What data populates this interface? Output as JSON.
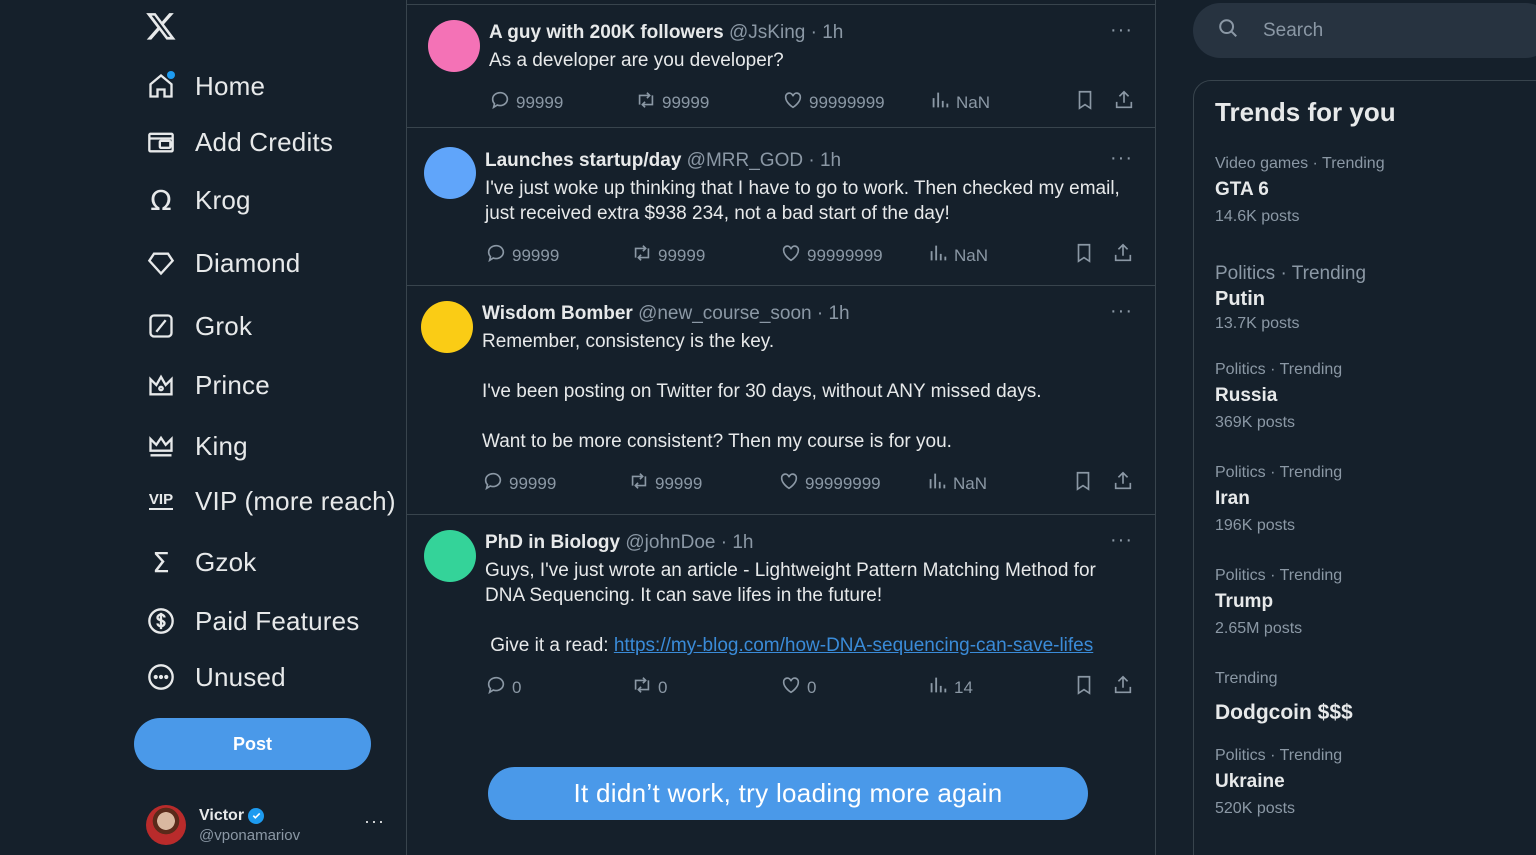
{
  "nav": {
    "items": [
      {
        "label": "Home"
      },
      {
        "label": "Add Credits"
      },
      {
        "label": "Krog"
      },
      {
        "label": "Diamond"
      },
      {
        "label": "Grok"
      },
      {
        "label": "Prince"
      },
      {
        "label": "King"
      },
      {
        "label": "VIP (more reach)"
      },
      {
        "label": "Gzok"
      },
      {
        "label": "Paid Features"
      },
      {
        "label": "Unused"
      }
    ],
    "post_label": "Post"
  },
  "profile": {
    "name": "Victor",
    "handle": "@vponamariov",
    "more": "···"
  },
  "tweets": [
    {
      "name": "A guy with 200K followers",
      "handle": "@JsKing",
      "time": "1h",
      "text": "As a developer are you developer?",
      "replies": "99999",
      "retweets": "99999",
      "likes": "99999999",
      "views": "NaN",
      "avatar_color": "#f472b6"
    },
    {
      "name": "Launches startup/day",
      "handle": "@MRR_GOD",
      "time": "1h",
      "text": "I've just woke up thinking that I have to go to work. Then checked my email, just received extra $938 234, not a bad start of the day!",
      "replies": "99999",
      "retweets": "99999",
      "likes": "99999999",
      "views": "NaN",
      "avatar_color": "#60a5fa"
    },
    {
      "name": "Wisdom Bomber",
      "handle": "@new_course_soon",
      "time": "1h",
      "text": "Remember, consistency is the key.\n\nI've been posting on Twitter for 30 days, without ANY missed days.\n\nWant to be more consistent? Then my course is for you.",
      "replies": "99999",
      "retweets": "99999",
      "likes": "99999999",
      "views": "NaN",
      "avatar_color": "#facc15"
    },
    {
      "name": "PhD in Biology",
      "handle": "@johnDoe",
      "time": "1h",
      "text": "Guys, I've just wrote an article - Lightweight Pattern Matching Method for DNA Sequencing. It can save lifes in the future!",
      "text2": " Give it a read: ",
      "link": "https://my-blog.com/how-DNA-sequencing-can-save-lifes",
      "replies": "0",
      "retweets": "0",
      "likes": "0",
      "views": "14",
      "avatar_color": "#34d399"
    }
  ],
  "load_more_label": "It didn’t work, try loading more again",
  "search": {
    "placeholder": "Search"
  },
  "trends": {
    "title": "Trends for you",
    "items": [
      {
        "meta": "Video games · Trending",
        "name": "GTA 6",
        "posts": "14.6K posts"
      },
      {
        "meta": "Politics · Trending",
        "name": "Putin",
        "posts": "13.7K posts"
      },
      {
        "meta": "Politics · Trending",
        "name": "Russia",
        "posts": "369K posts"
      },
      {
        "meta": "Politics · Trending",
        "name": "Iran",
        "posts": "196K posts"
      },
      {
        "meta": "Politics · Trending",
        "name": "Trump",
        "posts": "2.65M posts"
      },
      {
        "meta": "Trending",
        "name": "Dodgcoin $$$"
      },
      {
        "meta": "Politics · Trending",
        "name": "Ukraine",
        "posts": "520K posts"
      }
    ]
  },
  "colors": {
    "background": "#15202b",
    "accent": "#4a99e9",
    "muted": "#8b98a5",
    "link": "#3a8bd8"
  }
}
